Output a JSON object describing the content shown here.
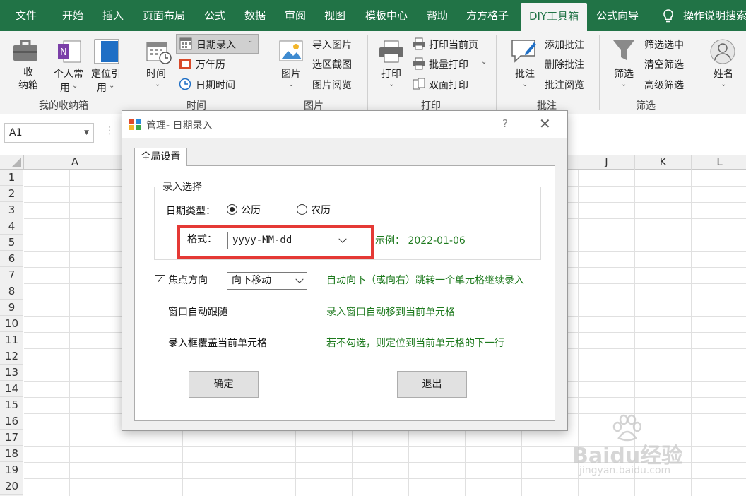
{
  "tabs": [
    "文件",
    "开始",
    "插入",
    "页面布局",
    "公式",
    "数据",
    "审阅",
    "视图",
    "模板中心",
    "帮助",
    "方方格子",
    "DIY工具箱",
    "公式向导",
    "操作说明搜索"
  ],
  "ribbon": {
    "g1": {
      "btn1": "收\n纳箱",
      "btn2": "个人常\n用",
      "btn3": "定位引\n用",
      "label": "我的收纳箱"
    },
    "g2": {
      "time": "时间",
      "date_entry": "日期录入",
      "perpetual_calendar": "万年历",
      "datetime": "日期时间",
      "label": "时间"
    },
    "g3": {
      "picture": "图片",
      "import": "导入图片",
      "screenshot": "选区截图",
      "browse": "图片阅览",
      "label": "图片"
    },
    "g4": {
      "print": "打印",
      "print_page": "打印当前页",
      "batch_print": "批量打印",
      "duplex": "双面打印",
      "label": "打印"
    },
    "g5": {
      "comment": "批注",
      "add": "添加批注",
      "delete": "删除批注",
      "browse": "批注阅览",
      "label": "批注"
    },
    "g6": {
      "filter": "筛选",
      "filter_sel": "筛选选中",
      "clear": "清空筛选",
      "advanced": "高级筛选",
      "label": "筛选"
    },
    "g7": {
      "name": "姓名"
    }
  },
  "namebox": "A1",
  "columns": [
    "A",
    "J",
    "K",
    "L"
  ],
  "rows": [
    "1",
    "2",
    "3",
    "4",
    "5",
    "6",
    "7",
    "8",
    "9",
    "10",
    "11",
    "12",
    "13",
    "14",
    "15",
    "16",
    "17",
    "18",
    "19",
    "20"
  ],
  "dialog": {
    "title": "管理- 日期录入",
    "help": "?",
    "close": "✕",
    "tab": "全局设置",
    "group_title": "录入选择",
    "date_type_label": "日期类型：",
    "gregorian": "公历",
    "lunar": "农历",
    "format_label": "格式：",
    "format_value": "yyyy-MM-dd",
    "example": "示例：  2022-01-06",
    "focus_label": "焦点方向",
    "focus_value": "向下移动",
    "focus_hint": "自动向下（或向右）跳转一个单元格继续录入",
    "follow_label": "窗口自动跟随",
    "follow_hint": "录入窗口自动移到当前单元格",
    "cover_label": "录入框覆盖当前单元格",
    "cover_hint": "若不勾选，则定位到当前单元格的下一行",
    "ok": "确定",
    "exit": "退出"
  },
  "watermark": {
    "brand": "Baidu经验",
    "url": "jingyan.baidu.com"
  }
}
